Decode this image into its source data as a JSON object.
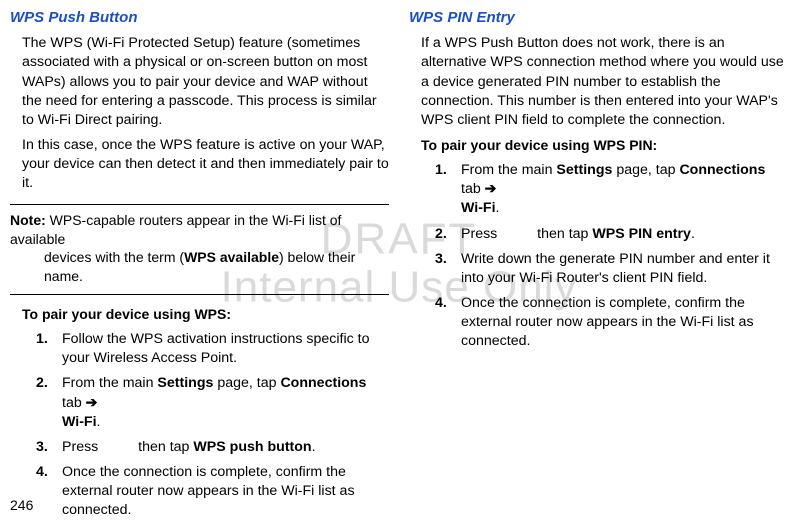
{
  "watermark": {
    "line1": "DRAFT",
    "line2": "Internal Use Only"
  },
  "left": {
    "heading": "WPS Push Button",
    "p1": "The WPS (Wi-Fi Protected Setup) feature (sometimes associated with a physical or on-screen button on most WAPs) allows you to pair your device and WAP without the need for entering a passcode. This process is similar to Wi-Fi Direct pairing.",
    "p2": "In this case, once the WPS feature is active on your WAP, your device can then detect it and then immediately pair to it.",
    "note_label": "Note:",
    "note_a": "WPS-capable routers appear in the Wi-Fi list of available",
    "note_b": "devices with the term (",
    "note_bold": "WPS available",
    "note_c": ") below their name.",
    "sub": "To pair your device using WPS:",
    "s1": "Follow the WPS activation instructions specific to your Wireless Access Point.",
    "s2a": "From the main ",
    "s2b": "Settings",
    "s2c": " page, tap ",
    "s2d": "Connections",
    "s2e": " tab ",
    "s2f": "➔",
    "s2g": "Wi-Fi",
    "s2h": ".",
    "s3a": "Press ",
    "s3b": " then tap ",
    "s3c": "WPS push button",
    "s3d": ".",
    "s4": "Once the connection is complete, confirm the external router now appears in the Wi-Fi list as connected."
  },
  "right": {
    "heading": "WPS PIN Entry",
    "p1": "If a WPS Push Button does not work, there is an alternative WPS connection method where you would use a device generated PIN number to establish the connection. This number is then entered into your WAP's WPS client PIN field to complete the connection.",
    "sub": "To pair your device using WPS PIN:",
    "s1a": "From the main ",
    "s1b": "Settings",
    "s1c": " page, tap ",
    "s1d": "Connections",
    "s1e": " tab ",
    "s1f": "➔",
    "s1g": "Wi-Fi",
    "s1h": ".",
    "s2a": "Press ",
    "s2b": " then tap ",
    "s2c": "WPS PIN entry",
    "s2d": ".",
    "s3": "Write down the generate PIN number and enter it into your Wi-Fi Router's client PIN field.",
    "s4": "Once the connection is complete, confirm the external router now appears in the Wi-Fi list as connected."
  },
  "page_number": "246"
}
